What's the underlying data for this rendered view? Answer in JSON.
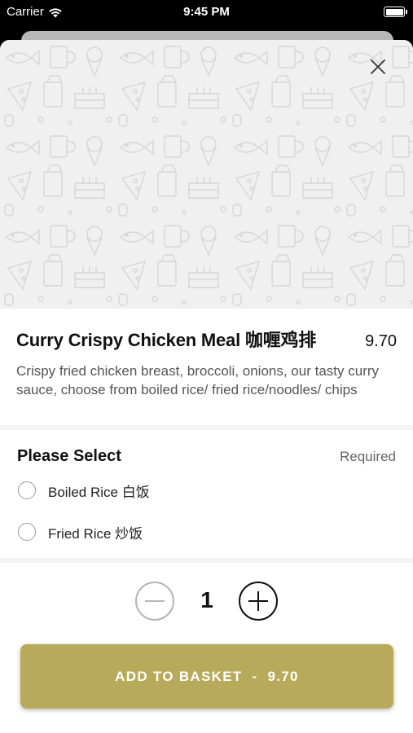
{
  "status_bar": {
    "carrier": "Carrier",
    "time": "9:45 PM"
  },
  "item": {
    "title": "Curry Crispy Chicken Meal 咖喱鸡排",
    "price": "9.70",
    "description": "Crispy fried chicken breast, broccoli, onions, our tasty curry sauce, choose from boiled rice/ fried rice/noodles/ chips"
  },
  "options": {
    "title": "Please Select",
    "required_label": "Required",
    "items": [
      {
        "label": "Boiled Rice 白饭"
      },
      {
        "label": "Fried Rice 炒饭"
      }
    ]
  },
  "quantity": {
    "value": "1"
  },
  "add_button": {
    "label": "ADD TO BASKET",
    "separator": "-",
    "price": "9.70"
  },
  "colors": {
    "accent": "#b7aa5a",
    "hero_bg": "#f0f0f0"
  },
  "icons": [
    "wifi-icon",
    "battery-icon",
    "close-icon",
    "minus-icon",
    "plus-icon",
    "food-pattern"
  ]
}
